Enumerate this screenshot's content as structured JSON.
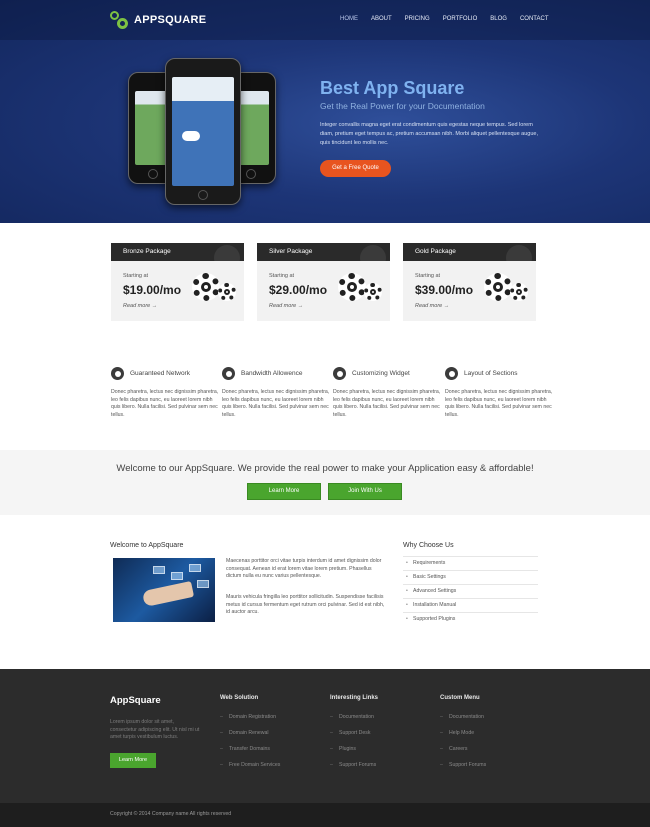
{
  "header": {
    "logo_text": "APPSQUARE",
    "nav": [
      "HOME",
      "ABOUT",
      "PRICING",
      "PORTFOLIO",
      "BLOG",
      "CONTACT"
    ]
  },
  "hero": {
    "title": "Best App Square",
    "subtitle": "Get the Real Power for your Documentation",
    "text": "Integer convallis magna eget erat condimentum quis egestas neque tempus. Sed lorem diam, pretium eget tempus ac, pretium accumsan nibh. Morbi aliquet pellentesque augue, quis tincidunt leo mollis nec.",
    "quote_button": "Get a Free Quote"
  },
  "packages": [
    {
      "name": "Bronze Package",
      "starting": "Starting at",
      "price": "$19.00/mo",
      "more": "Read more →"
    },
    {
      "name": "Silver Package",
      "starting": "Starting at",
      "price": "$29.00/mo",
      "more": "Read more →"
    },
    {
      "name": "Gold Package",
      "starting": "Starting at",
      "price": "$39.00/mo",
      "more": "Read more →"
    }
  ],
  "features": [
    {
      "title": "Guaranteed Network",
      "icon": "heart-icon",
      "text": "Donec pharetra, lectus nec dignissim pharetra, leo felis dapibus nunc, eu laoreet lorem nibh quis libero. Nulla facilisi. Sed pulvinar sem nec tellus."
    },
    {
      "title": "Bandwidth Allowence",
      "icon": "target-icon",
      "text": "Donec pharetra, lectus nec dignissim pharetra, leo felis dapibus nunc, eu laoreet lorem nibh quis libero. Nulla facilisi. Sed pulvinar sem nec tellus."
    },
    {
      "title": "Customizing Widget",
      "icon": "wrench-icon",
      "text": "Donec pharetra, lectus nec dignissim pharetra, leo felis dapibus nunc, eu laoreet lorem nibh quis libero. Nulla facilisi. Sed pulvinar sem nec tellus."
    },
    {
      "title": "Layout of Sections",
      "icon": "compass-icon",
      "text": "Donec pharetra, lectus nec dignissim pharetra, leo felis dapibus nunc, eu laoreet lorem nibh quis libero. Nulla facilisi. Sed pulvinar sem nec tellus."
    }
  ],
  "band": {
    "message": "Welcome to our AppSquare. We provide the real power to make your Application easy & affordable!",
    "learn_more": "Learn More",
    "join": "Join With Us"
  },
  "welcome": {
    "heading": "Welcome to AppSquare",
    "p1": "Maecenas porttitor orci vitae turpis interdum id amet dignissim dolor consequat. Aenean id erat lorem vitae lorem pretium. Phasellus dictum nulla eu nunc varius pellentesque.",
    "p2": "Mauris vehicula fringilla leo porttitor sollicitudin. Suspendisse facilisis metus id cursus fermentum eget rutrum orci pulvinar. Sed id est nibh, id auctor arcu."
  },
  "why": {
    "heading": "Why Choose Us",
    "items": [
      "Requirements",
      "Basic Settings",
      "Advanced Settings",
      "Installation Manual",
      "Supported Plugins"
    ]
  },
  "footer": {
    "brand": "AppSquare",
    "text": "Lorem ipsum dolor sit amet, consectetur adipiscing elit. Ut nisl mi ut amet turpis vestibulum luctus.",
    "learn_more": "Learn More",
    "columns": [
      {
        "heading": "Web Solution",
        "items": [
          "Domain Registration",
          "Domain Renewal",
          "Transfer Domains",
          "Free Domain Services"
        ]
      },
      {
        "heading": "Interesting Links",
        "items": [
          "Documentation",
          "Support Desk",
          "Plugins",
          "Support Forums"
        ]
      },
      {
        "heading": "Custom Menu",
        "items": [
          "Documentation",
          "Help Mode",
          "Careers",
          "Support Forums"
        ]
      }
    ],
    "copyright": "Copyright © 2014 Company name All rights reserved"
  }
}
